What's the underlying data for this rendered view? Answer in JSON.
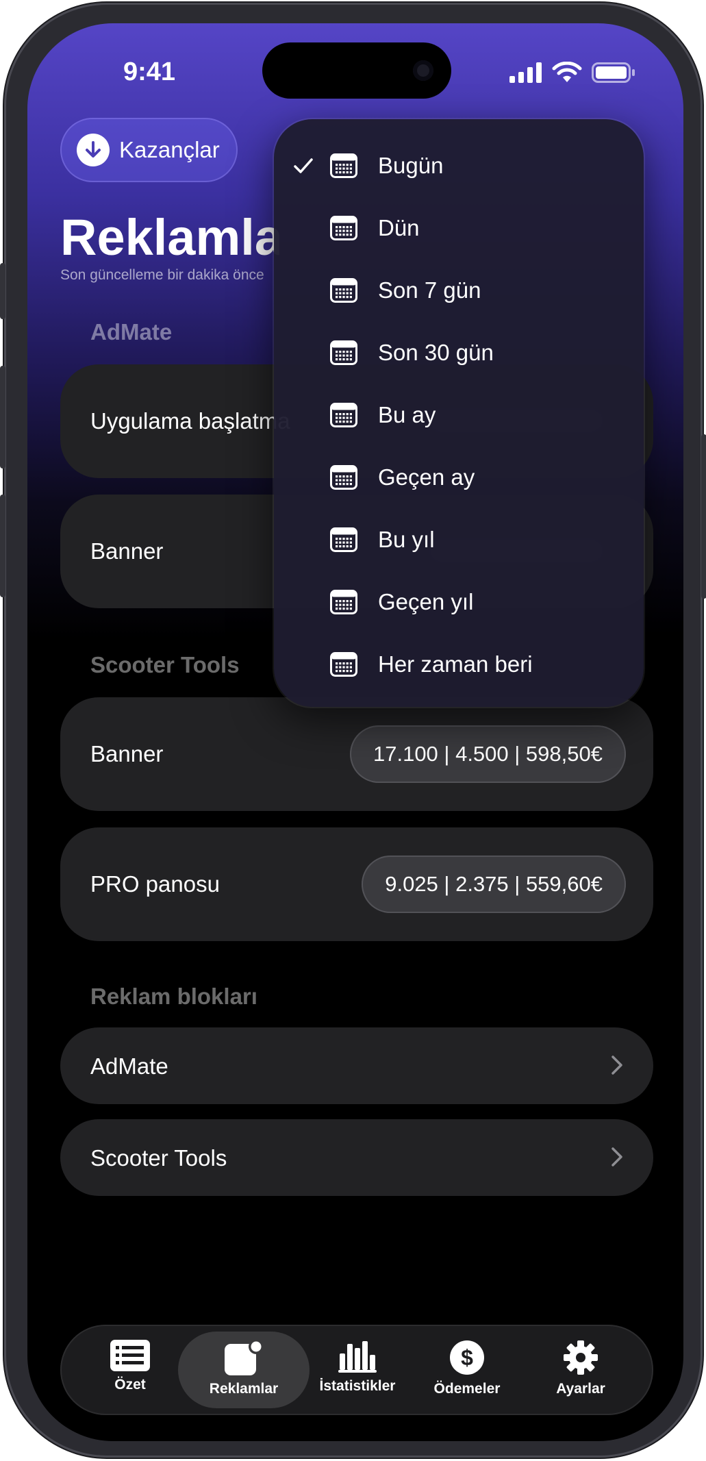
{
  "status_bar": {
    "time": "9:41"
  },
  "header": {
    "earnings_button": "Kazançlar",
    "title": "Reklamlar",
    "subtitle": "Son güncelleme bir dakika önce"
  },
  "sections": {
    "admate": {
      "label": "AdMate",
      "rows": [
        {
          "label": "Uygulama başlatma"
        },
        {
          "label": "Banner"
        }
      ]
    },
    "scooter_tools": {
      "label": "Scooter Tools",
      "rows": [
        {
          "label": "Banner",
          "stats": "17.100 | 4.500 | 598,50€"
        },
        {
          "label": "PRO panosu",
          "stats": "9.025 | 2.375 | 559,60€"
        }
      ]
    },
    "ad_blocks": {
      "label": "Reklam blokları",
      "rows": [
        {
          "label": "AdMate"
        },
        {
          "label": "Scooter Tools"
        }
      ]
    }
  },
  "date_menu": {
    "selected_index": 0,
    "items": [
      {
        "label": "Bugün"
      },
      {
        "label": "Dün"
      },
      {
        "label": "Son 7 gün"
      },
      {
        "label": "Son 30 gün"
      },
      {
        "label": "Bu ay"
      },
      {
        "label": "Geçen ay"
      },
      {
        "label": "Bu yıl"
      },
      {
        "label": "Geçen yıl"
      },
      {
        "label": "Her zaman beri"
      }
    ]
  },
  "tabbar": {
    "active": "reklamlar",
    "tabs": [
      {
        "id": "ozet",
        "label": "Özet",
        "icon": "list-icon"
      },
      {
        "id": "reklamlar",
        "label": "Reklamlar",
        "icon": "app-badge-icon"
      },
      {
        "id": "istatistikler",
        "label": "İstatistikler",
        "icon": "bar-chart-icon"
      },
      {
        "id": "odemeler",
        "label": "Ödemeler",
        "icon": "dollar-icon"
      },
      {
        "id": "ayarlar",
        "label": "Ayarlar",
        "icon": "gear-icon"
      }
    ]
  },
  "colors": {
    "accent": "#5545c6",
    "card_bg": "#222224",
    "menu_bg": "#1e1c30"
  }
}
